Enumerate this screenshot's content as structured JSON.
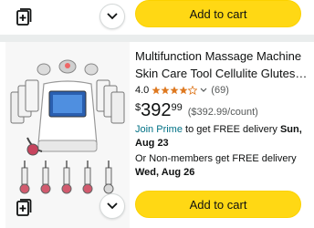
{
  "top_card": {
    "add_to_cart_label": "Add to cart"
  },
  "product": {
    "title": "Multifunction Massage Machine Skin Care Tool Cellulite Glutes…",
    "rating_value": "4.0",
    "rating_count": "(69)",
    "stars_filled": 4,
    "price_currency": "$",
    "price_whole": "392",
    "price_fraction": "99",
    "price_per_unit": "($392.99/count)",
    "prime_link": "Join Prime",
    "prime_text": " to get FREE delivery ",
    "prime_date": "Sun, Aug 23",
    "nonmember_text": "Or Non-members get FREE delivery ",
    "nonmember_date": "Wed, Aug 26",
    "add_to_cart_label": "Add to cart"
  },
  "colors": {
    "cart_button": "#ffd814",
    "link": "#007185",
    "star": "#de7921"
  },
  "icons": [
    "add-to-list-icon",
    "chevron-down-icon",
    "star-icon"
  ]
}
